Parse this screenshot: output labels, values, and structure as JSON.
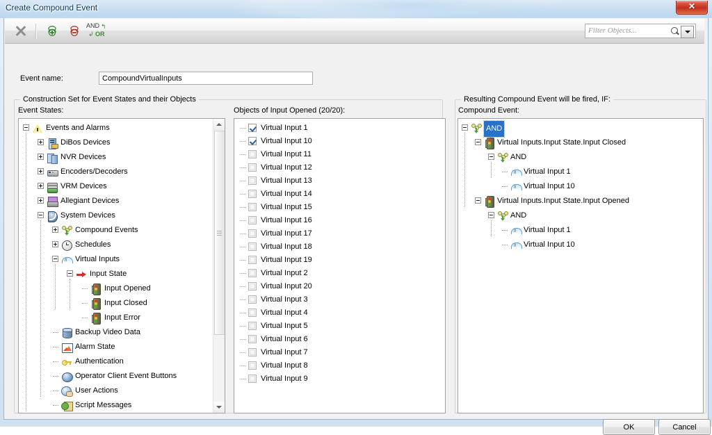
{
  "window": {
    "title": "Create Compound Event",
    "close_label": "✕"
  },
  "toolbar": {
    "buttons": [
      {
        "name": "delete-icon",
        "label": ""
      },
      {
        "name": "add-event-state-icon",
        "label": ""
      },
      {
        "name": "remove-event-state-icon",
        "label": ""
      },
      {
        "name": "and-or-toggle-icon",
        "label_and": "AND",
        "label_or": "OR"
      }
    ],
    "filter": {
      "placeholder": "Filter Objects...",
      "value": ""
    }
  },
  "form": {
    "event_name_label": "Event name:",
    "event_name_value": "CompoundVirtualInputs"
  },
  "construction": {
    "legend": "Construction Set for Event States and their Objects",
    "event_states_label": "Event States:",
    "objects_label": "Objects of Input Opened (20/20):"
  },
  "result": {
    "legend": "Resulting Compound Event will be fired, IF:",
    "compound_event_label": "Compound Event:"
  },
  "event_states_tree": [
    {
      "label": "Events and Alarms",
      "depth": 0,
      "icon": "warning-triangle-icon",
      "expander": "minus"
    },
    {
      "label": "DiBos Devices",
      "depth": 1,
      "icon": "dibos-device-icon",
      "expander": "plus"
    },
    {
      "label": "NVR Devices",
      "depth": 1,
      "icon": "nvr-device-icon",
      "expander": "plus"
    },
    {
      "label": "Encoders/Decoders",
      "depth": 1,
      "icon": "encoder-decoder-icon",
      "expander": "plus"
    },
    {
      "label": "VRM Devices",
      "depth": 1,
      "icon": "vrm-device-icon",
      "expander": "plus"
    },
    {
      "label": "Allegiant Devices",
      "depth": 1,
      "icon": "allegiant-device-icon",
      "expander": "plus"
    },
    {
      "label": "System Devices",
      "depth": 1,
      "icon": "system-device-icon",
      "expander": "minus"
    },
    {
      "label": "Compound Events",
      "depth": 2,
      "icon": "compound-event-icon",
      "expander": "plus"
    },
    {
      "label": "Schedules",
      "depth": 2,
      "icon": "schedule-clock-icon",
      "expander": "plus"
    },
    {
      "label": "Virtual Inputs",
      "depth": 2,
      "icon": "virtual-input-icon",
      "expander": "minus"
    },
    {
      "label": "Input State",
      "depth": 3,
      "icon": "input-state-arrow-icon",
      "expander": "minus"
    },
    {
      "label": "Input Opened",
      "depth": 4,
      "icon": "traffic-light-icon",
      "expander": "none"
    },
    {
      "label": "Input Closed",
      "depth": 4,
      "icon": "traffic-light-icon",
      "expander": "none"
    },
    {
      "label": "Input Error",
      "depth": 4,
      "icon": "traffic-light-icon",
      "expander": "none"
    },
    {
      "label": "Backup Video Data",
      "depth": 2,
      "icon": "database-icon",
      "expander": "none"
    },
    {
      "label": "Alarm State",
      "depth": 2,
      "icon": "alarm-state-icon",
      "expander": "none"
    },
    {
      "label": "Authentication",
      "depth": 2,
      "icon": "key-icon",
      "expander": "none"
    },
    {
      "label": "Operator Client Event Buttons",
      "depth": 2,
      "icon": "sphere-button-icon",
      "expander": "none"
    },
    {
      "label": "User Actions",
      "depth": 2,
      "icon": "user-actions-icon",
      "expander": "none"
    },
    {
      "label": "Script Messages",
      "depth": 2,
      "icon": "script-messages-icon",
      "expander": "none"
    }
  ],
  "objects_list": [
    {
      "label": "Virtual Input 1",
      "checked": true
    },
    {
      "label": "Virtual Input 10",
      "checked": true
    },
    {
      "label": "Virtual Input 11",
      "checked": false
    },
    {
      "label": "Virtual Input 12",
      "checked": false
    },
    {
      "label": "Virtual Input 13",
      "checked": false
    },
    {
      "label": "Virtual Input 14",
      "checked": false
    },
    {
      "label": "Virtual Input 15",
      "checked": false
    },
    {
      "label": "Virtual Input 16",
      "checked": false
    },
    {
      "label": "Virtual Input 17",
      "checked": false
    },
    {
      "label": "Virtual Input 18",
      "checked": false
    },
    {
      "label": "Virtual Input 19",
      "checked": false
    },
    {
      "label": "Virtual Input 2",
      "checked": false
    },
    {
      "label": "Virtual Input 20",
      "checked": false
    },
    {
      "label": "Virtual Input 3",
      "checked": false
    },
    {
      "label": "Virtual Input 4",
      "checked": false
    },
    {
      "label": "Virtual Input 5",
      "checked": false
    },
    {
      "label": "Virtual Input 6",
      "checked": false
    },
    {
      "label": "Virtual Input 7",
      "checked": false
    },
    {
      "label": "Virtual Input 8",
      "checked": false
    },
    {
      "label": "Virtual Input 9",
      "checked": false
    }
  ],
  "compound_tree": [
    {
      "label": "AND",
      "depth": 0,
      "icon": "compound-event-icon",
      "expander": "minus",
      "selected": true
    },
    {
      "label": "Virtual Inputs.Input State.Input Closed",
      "depth": 1,
      "icon": "traffic-light-icon",
      "expander": "minus",
      "selected": false
    },
    {
      "label": "AND",
      "depth": 2,
      "icon": "compound-event-icon",
      "expander": "minus",
      "selected": false
    },
    {
      "label": "Virtual Input 1",
      "depth": 3,
      "icon": "virtual-input-icon",
      "expander": "none",
      "selected": false
    },
    {
      "label": "Virtual Input 10",
      "depth": 3,
      "icon": "virtual-input-icon",
      "expander": "none",
      "selected": false
    },
    {
      "label": "Virtual Inputs.Input State.Input Opened",
      "depth": 1,
      "icon": "traffic-light-icon",
      "expander": "minus",
      "selected": false
    },
    {
      "label": "AND",
      "depth": 2,
      "icon": "compound-event-icon",
      "expander": "minus",
      "selected": false
    },
    {
      "label": "Virtual Input 1",
      "depth": 3,
      "icon": "virtual-input-icon",
      "expander": "none",
      "selected": false
    },
    {
      "label": "Virtual Input 10",
      "depth": 3,
      "icon": "virtual-input-icon",
      "expander": "none",
      "selected": false
    }
  ],
  "footer": {
    "ok_label": "OK",
    "cancel_label": "Cancel"
  },
  "colors": {
    "title_text": "#0b3b63",
    "selection": "#2a72c8",
    "close_button": "#c42f1b",
    "glass_top": "#dce9f6"
  }
}
